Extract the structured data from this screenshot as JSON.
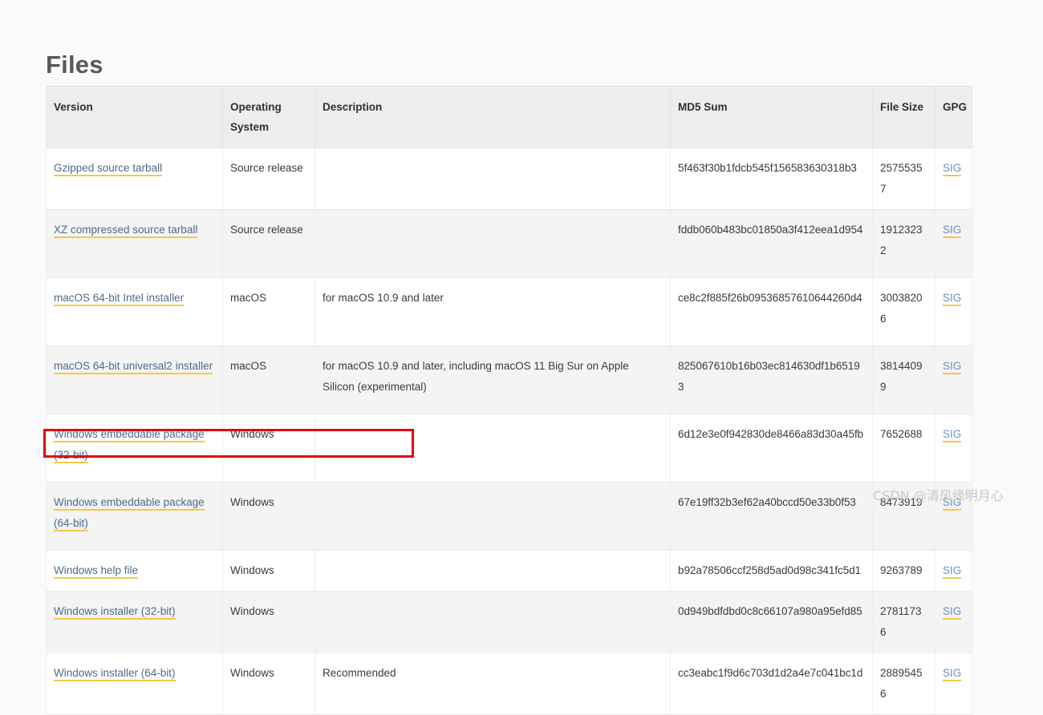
{
  "page": {
    "title": "Files",
    "background_color": "#fafafa",
    "link_color": "#4d6a8a",
    "link_underline_color": "#f6c744",
    "highlight_color": "#e60012"
  },
  "watermark": {
    "text": "CSDN @清风缘明月心"
  },
  "table": {
    "columns": [
      {
        "key": "version",
        "label": "Version"
      },
      {
        "key": "os",
        "label": "Operating System"
      },
      {
        "key": "description",
        "label": "Description"
      },
      {
        "key": "md5",
        "label": "MD5 Sum"
      },
      {
        "key": "size",
        "label": "File Size"
      },
      {
        "key": "gpg",
        "label": "GPG"
      }
    ],
    "gpg_link_label": "SIG",
    "rows": [
      {
        "version": "Gzipped source tarball",
        "os": "Source release",
        "description": "",
        "md5": "5f463f30b1fdcb545f156583630318b3",
        "size": "25755357",
        "gpg": "SIG",
        "highlighted": false
      },
      {
        "version": "XZ compressed source tarball",
        "os": "Source release",
        "description": "",
        "md5": "fddb060b483bc01850a3f412eea1d954",
        "size": "19123232",
        "gpg": "SIG",
        "highlighted": false
      },
      {
        "version": "macOS 64-bit Intel installer",
        "os": "macOS",
        "description": "for macOS 10.9 and later",
        "md5": "ce8c2f885f26b09536857610644260d4",
        "size": "30038206",
        "gpg": "SIG",
        "highlighted": false
      },
      {
        "version": "macOS 64-bit universal2 installer",
        "os": "macOS",
        "description": "for macOS 10.9 and later, including macOS 11 Big Sur on Apple Silicon (experimental)",
        "md5": "825067610b16b03ec814630df1b65193",
        "size": "38144099",
        "gpg": "SIG",
        "highlighted": false
      },
      {
        "version": "Windows embeddable package (32-bit)",
        "os": "Windows",
        "description": "",
        "md5": "6d12e3e0f942830de8466a83d30a45fb",
        "size": "7652688",
        "gpg": "SIG",
        "highlighted": false
      },
      {
        "version": "Windows embeddable package (64-bit)",
        "os": "Windows",
        "description": "",
        "md5": "67e19ff32b3ef62a40bccd50e33b0f53",
        "size": "8473919",
        "gpg": "SIG",
        "highlighted": false
      },
      {
        "version": "Windows help file",
        "os": "Windows",
        "description": "",
        "md5": "b92a78506ccf258d5ad0d98c341fc5d1",
        "size": "9263789",
        "gpg": "SIG",
        "highlighted": false
      },
      {
        "version": "Windows installer (32-bit)",
        "os": "Windows",
        "description": "",
        "md5": "0d949bdfdbd0c8c66107a980a95efd85",
        "size": "27811736",
        "gpg": "SIG",
        "highlighted": false
      },
      {
        "version": "Windows installer (64-bit)",
        "os": "Windows",
        "description": "Recommended",
        "md5": "cc3eabc1f9d6c703d1d2a4e7c041bc1d",
        "size": "28895456",
        "gpg": "SIG",
        "highlighted": true
      }
    ]
  }
}
